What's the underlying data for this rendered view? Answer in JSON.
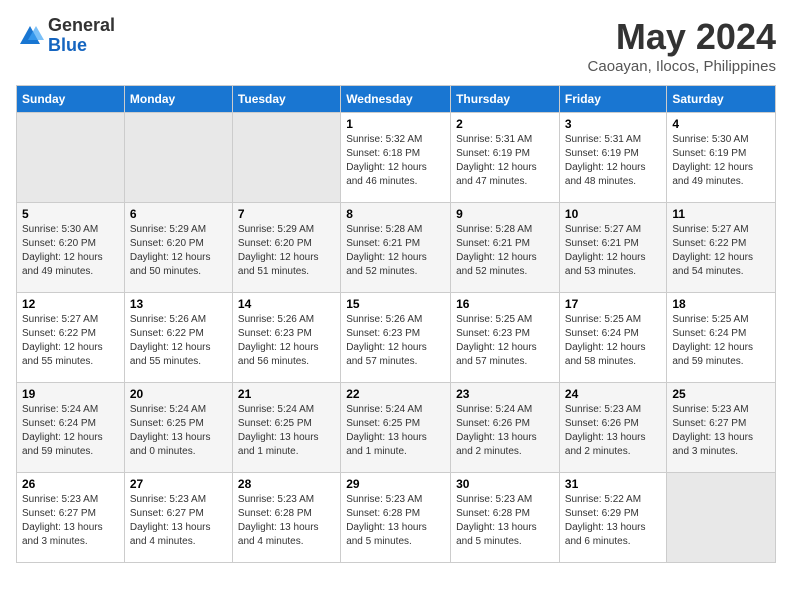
{
  "header": {
    "logo_general": "General",
    "logo_blue": "Blue",
    "month_year": "May 2024",
    "location": "Caoayan, Ilocos, Philippines"
  },
  "weekdays": [
    "Sunday",
    "Monday",
    "Tuesday",
    "Wednesday",
    "Thursday",
    "Friday",
    "Saturday"
  ],
  "weeks": [
    [
      {
        "day": "",
        "info": ""
      },
      {
        "day": "",
        "info": ""
      },
      {
        "day": "",
        "info": ""
      },
      {
        "day": "1",
        "info": "Sunrise: 5:32 AM\nSunset: 6:18 PM\nDaylight: 12 hours\nand 46 minutes."
      },
      {
        "day": "2",
        "info": "Sunrise: 5:31 AM\nSunset: 6:19 PM\nDaylight: 12 hours\nand 47 minutes."
      },
      {
        "day": "3",
        "info": "Sunrise: 5:31 AM\nSunset: 6:19 PM\nDaylight: 12 hours\nand 48 minutes."
      },
      {
        "day": "4",
        "info": "Sunrise: 5:30 AM\nSunset: 6:19 PM\nDaylight: 12 hours\nand 49 minutes."
      }
    ],
    [
      {
        "day": "5",
        "info": "Sunrise: 5:30 AM\nSunset: 6:20 PM\nDaylight: 12 hours\nand 49 minutes."
      },
      {
        "day": "6",
        "info": "Sunrise: 5:29 AM\nSunset: 6:20 PM\nDaylight: 12 hours\nand 50 minutes."
      },
      {
        "day": "7",
        "info": "Sunrise: 5:29 AM\nSunset: 6:20 PM\nDaylight: 12 hours\nand 51 minutes."
      },
      {
        "day": "8",
        "info": "Sunrise: 5:28 AM\nSunset: 6:21 PM\nDaylight: 12 hours\nand 52 minutes."
      },
      {
        "day": "9",
        "info": "Sunrise: 5:28 AM\nSunset: 6:21 PM\nDaylight: 12 hours\nand 52 minutes."
      },
      {
        "day": "10",
        "info": "Sunrise: 5:27 AM\nSunset: 6:21 PM\nDaylight: 12 hours\nand 53 minutes."
      },
      {
        "day": "11",
        "info": "Sunrise: 5:27 AM\nSunset: 6:22 PM\nDaylight: 12 hours\nand 54 minutes."
      }
    ],
    [
      {
        "day": "12",
        "info": "Sunrise: 5:27 AM\nSunset: 6:22 PM\nDaylight: 12 hours\nand 55 minutes."
      },
      {
        "day": "13",
        "info": "Sunrise: 5:26 AM\nSunset: 6:22 PM\nDaylight: 12 hours\nand 55 minutes."
      },
      {
        "day": "14",
        "info": "Sunrise: 5:26 AM\nSunset: 6:23 PM\nDaylight: 12 hours\nand 56 minutes."
      },
      {
        "day": "15",
        "info": "Sunrise: 5:26 AM\nSunset: 6:23 PM\nDaylight: 12 hours\nand 57 minutes."
      },
      {
        "day": "16",
        "info": "Sunrise: 5:25 AM\nSunset: 6:23 PM\nDaylight: 12 hours\nand 57 minutes."
      },
      {
        "day": "17",
        "info": "Sunrise: 5:25 AM\nSunset: 6:24 PM\nDaylight: 12 hours\nand 58 minutes."
      },
      {
        "day": "18",
        "info": "Sunrise: 5:25 AM\nSunset: 6:24 PM\nDaylight: 12 hours\nand 59 minutes."
      }
    ],
    [
      {
        "day": "19",
        "info": "Sunrise: 5:24 AM\nSunset: 6:24 PM\nDaylight: 12 hours\nand 59 minutes."
      },
      {
        "day": "20",
        "info": "Sunrise: 5:24 AM\nSunset: 6:25 PM\nDaylight: 13 hours\nand 0 minutes."
      },
      {
        "day": "21",
        "info": "Sunrise: 5:24 AM\nSunset: 6:25 PM\nDaylight: 13 hours\nand 1 minute."
      },
      {
        "day": "22",
        "info": "Sunrise: 5:24 AM\nSunset: 6:25 PM\nDaylight: 13 hours\nand 1 minute."
      },
      {
        "day": "23",
        "info": "Sunrise: 5:24 AM\nSunset: 6:26 PM\nDaylight: 13 hours\nand 2 minutes."
      },
      {
        "day": "24",
        "info": "Sunrise: 5:23 AM\nSunset: 6:26 PM\nDaylight: 13 hours\nand 2 minutes."
      },
      {
        "day": "25",
        "info": "Sunrise: 5:23 AM\nSunset: 6:27 PM\nDaylight: 13 hours\nand 3 minutes."
      }
    ],
    [
      {
        "day": "26",
        "info": "Sunrise: 5:23 AM\nSunset: 6:27 PM\nDaylight: 13 hours\nand 3 minutes."
      },
      {
        "day": "27",
        "info": "Sunrise: 5:23 AM\nSunset: 6:27 PM\nDaylight: 13 hours\nand 4 minutes."
      },
      {
        "day": "28",
        "info": "Sunrise: 5:23 AM\nSunset: 6:28 PM\nDaylight: 13 hours\nand 4 minutes."
      },
      {
        "day": "29",
        "info": "Sunrise: 5:23 AM\nSunset: 6:28 PM\nDaylight: 13 hours\nand 5 minutes."
      },
      {
        "day": "30",
        "info": "Sunrise: 5:23 AM\nSunset: 6:28 PM\nDaylight: 13 hours\nand 5 minutes."
      },
      {
        "day": "31",
        "info": "Sunrise: 5:22 AM\nSunset: 6:29 PM\nDaylight: 13 hours\nand 6 minutes."
      },
      {
        "day": "",
        "info": ""
      }
    ]
  ]
}
